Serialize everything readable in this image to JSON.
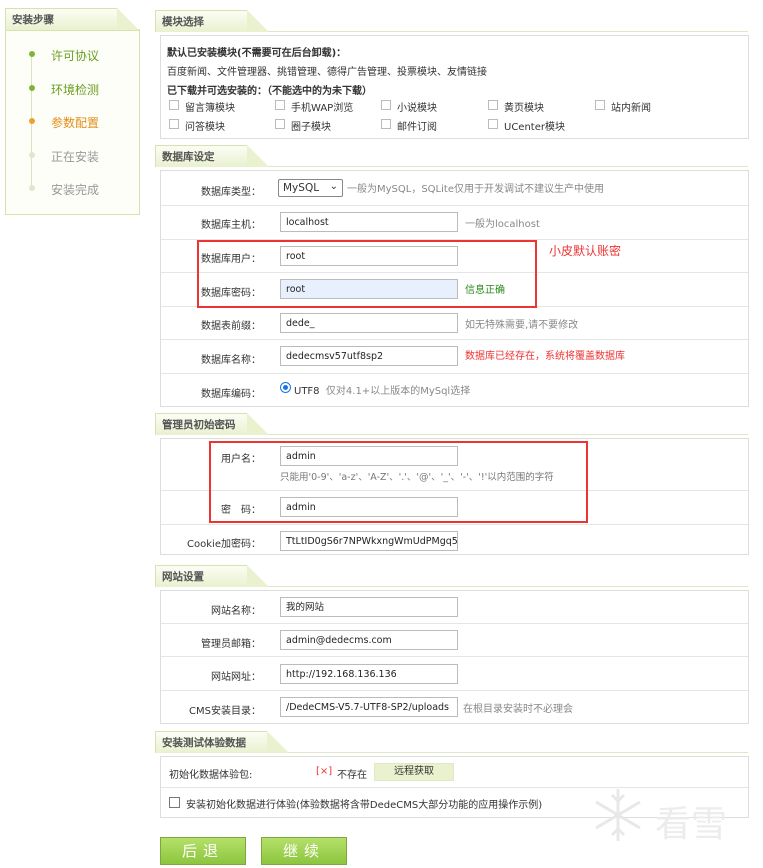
{
  "sidebar": {
    "title": "安装步骤",
    "steps": [
      {
        "label": "许可协议",
        "state": "done"
      },
      {
        "label": "环境检测",
        "state": "done"
      },
      {
        "label": "参数配置",
        "state": "current"
      },
      {
        "label": "正在安装",
        "state": "todo"
      },
      {
        "label": "安装完成",
        "state": "todo"
      }
    ]
  },
  "modules": {
    "section_title": "模块选择",
    "installed_heading": "默认已安装模块(不需要可在后台卸载)：",
    "installed_list": "百度新闻、文件管理器、挑错管理、德得广告管理、投票模块、友情链接",
    "downloadable_heading": "已下载并可选安装的：（不能选中的为未下载）",
    "items": [
      "留言簿模块",
      "手机WAP浏览",
      "小说模块",
      "黄页模块",
      "站内新闻",
      "问答模块",
      "圈子模块",
      "邮件订阅",
      "UCenter模块"
    ]
  },
  "database": {
    "section_title": "数据库设定",
    "type_label": "数据库类型：",
    "type_value": "MySQL",
    "type_note": "一般为MySQL，SQLite仅用于开发调试不建议生产中使用",
    "host_label": "数据库主机：",
    "host_value": "localhost",
    "host_note": "一般为localhost",
    "user_label": "数据库用户：",
    "user_value": "root",
    "pwd_label": "数据库密码：",
    "pwd_value": "root",
    "pwd_note": "信息正确",
    "prefix_label": "数据表前缀：",
    "prefix_value": "dede_",
    "prefix_note": "如无特殊需要,请不要修改",
    "name_label": "数据库名称：",
    "name_value": "dedecmsv57utf8sp2",
    "name_note": "数据库已经存在，系统将覆盖数据库",
    "encoding_label": "数据库编码：",
    "encoding_value": "UTF8",
    "encoding_note": "仅对4.1+以上版本的MySql选择",
    "annotation": "小皮默认账密"
  },
  "admin": {
    "section_title": "管理员初始密码",
    "user_label": "用户名：",
    "user_value": "admin",
    "user_hint": "只能用'0-9'、'a-z'、'A-Z'、'.'、'@'、'_'、'-'、'!'以内范围的字符",
    "pwd_label": "密　码：",
    "pwd_value": "admin",
    "cookie_label": "Cookie加密码：",
    "cookie_value": "TtLtID0gS6r7NPWkxngWmUdPMgq5"
  },
  "site": {
    "section_title": "网站设置",
    "name_label": "网站名称：",
    "name_value": "我的网站",
    "email_label": "管理员邮箱：",
    "email_value": "admin@dedecms.com",
    "url_label": "网站网址：",
    "url_value": "http://192.168.136.136",
    "dir_label": "CMS安装目录：",
    "dir_value": "/DedeCMS-V5.7-UTF8-SP2/uploads",
    "dir_note": "在根目录安装时不必理会"
  },
  "demo": {
    "section_title": "安装测试体验数据",
    "package_label": "初始化数据体验包:",
    "status_mark": "[×]",
    "status_text": "不存在",
    "fetch_button": "远程获取",
    "install_label": "安装初始化数据进行体验(体验数据将含带DedeCMS大部分功能的应用操作示例)"
  },
  "buttons": {
    "back": "后退",
    "next": "继续"
  },
  "watermark": "看雪",
  "colors": {
    "accent_green": "#6a9d1f",
    "current_orange": "#e58d17",
    "annotation_red": "#e33333",
    "ok_green": "#2a8a1a"
  }
}
